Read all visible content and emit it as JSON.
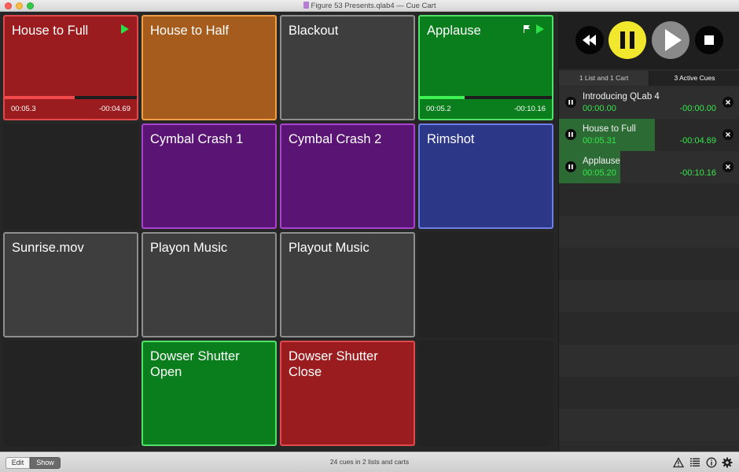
{
  "window": {
    "title": "Figure 53 Presents.qlab4 — Cue Cart"
  },
  "cart": {
    "cues": [
      {
        "name": "House to Full",
        "color": "red",
        "status": "playing",
        "show_flag": false,
        "elapsed": "00:05.3",
        "remaining": "-00:04.69",
        "progress": 0.53
      },
      {
        "name": "House to Half",
        "color": "orange",
        "status": "idle"
      },
      {
        "name": "Blackout",
        "color": "gray",
        "status": "idle"
      },
      {
        "name": "Applause",
        "color": "green",
        "status": "playing",
        "show_flag": true,
        "elapsed": "00:05.2",
        "remaining": "-00:10.16",
        "progress": 0.34
      },
      {
        "name": "",
        "color": "empty",
        "status": "empty"
      },
      {
        "name": "Cymbal Crash 1",
        "color": "purple",
        "status": "idle"
      },
      {
        "name": "Cymbal Crash 2",
        "color": "purple",
        "status": "idle"
      },
      {
        "name": "Rimshot",
        "color": "blue",
        "status": "idle"
      },
      {
        "name": "Sunrise.mov",
        "color": "gray",
        "status": "idle"
      },
      {
        "name": "Playon Music",
        "color": "gray",
        "status": "idle"
      },
      {
        "name": "Playout Music",
        "color": "gray",
        "status": "idle"
      },
      {
        "name": "",
        "color": "empty",
        "status": "empty"
      },
      {
        "name": "",
        "color": "empty",
        "status": "empty"
      },
      {
        "name": "Dowser Shutter Open",
        "color": "green",
        "status": "idle"
      },
      {
        "name": "Dowser Shutter Close",
        "color": "red",
        "status": "idle"
      },
      {
        "name": "",
        "color": "empty",
        "status": "empty"
      }
    ]
  },
  "transport": {
    "icons": [
      "rewind-icon",
      "pause-icon",
      "play-icon",
      "stop-icon"
    ],
    "pause_color": "#f1e82e"
  },
  "side_tabs": {
    "lists_label": "1 List and 1 Cart",
    "active_label": "3 Active Cues"
  },
  "active_cues": [
    {
      "name": "Introducing QLab 4",
      "elapsed": "00:00.00",
      "remaining": "-00:00.00",
      "progress": 0.0
    },
    {
      "name": "House to Full",
      "elapsed": "00:05.31",
      "remaining": "-00:04.69",
      "progress": 0.53
    },
    {
      "name": "Applause",
      "elapsed": "00:05.20",
      "remaining": "-00:10.16",
      "progress": 0.34
    }
  ],
  "footer": {
    "edit_label": "Edit",
    "show_label": "Show",
    "status": "24 cues in 2 lists and carts",
    "icons": [
      "warning-icon",
      "list-icon",
      "info-icon",
      "gear-icon"
    ]
  },
  "colors": {
    "accent_green_text": "#35e84b",
    "play_green": "#29e046"
  }
}
